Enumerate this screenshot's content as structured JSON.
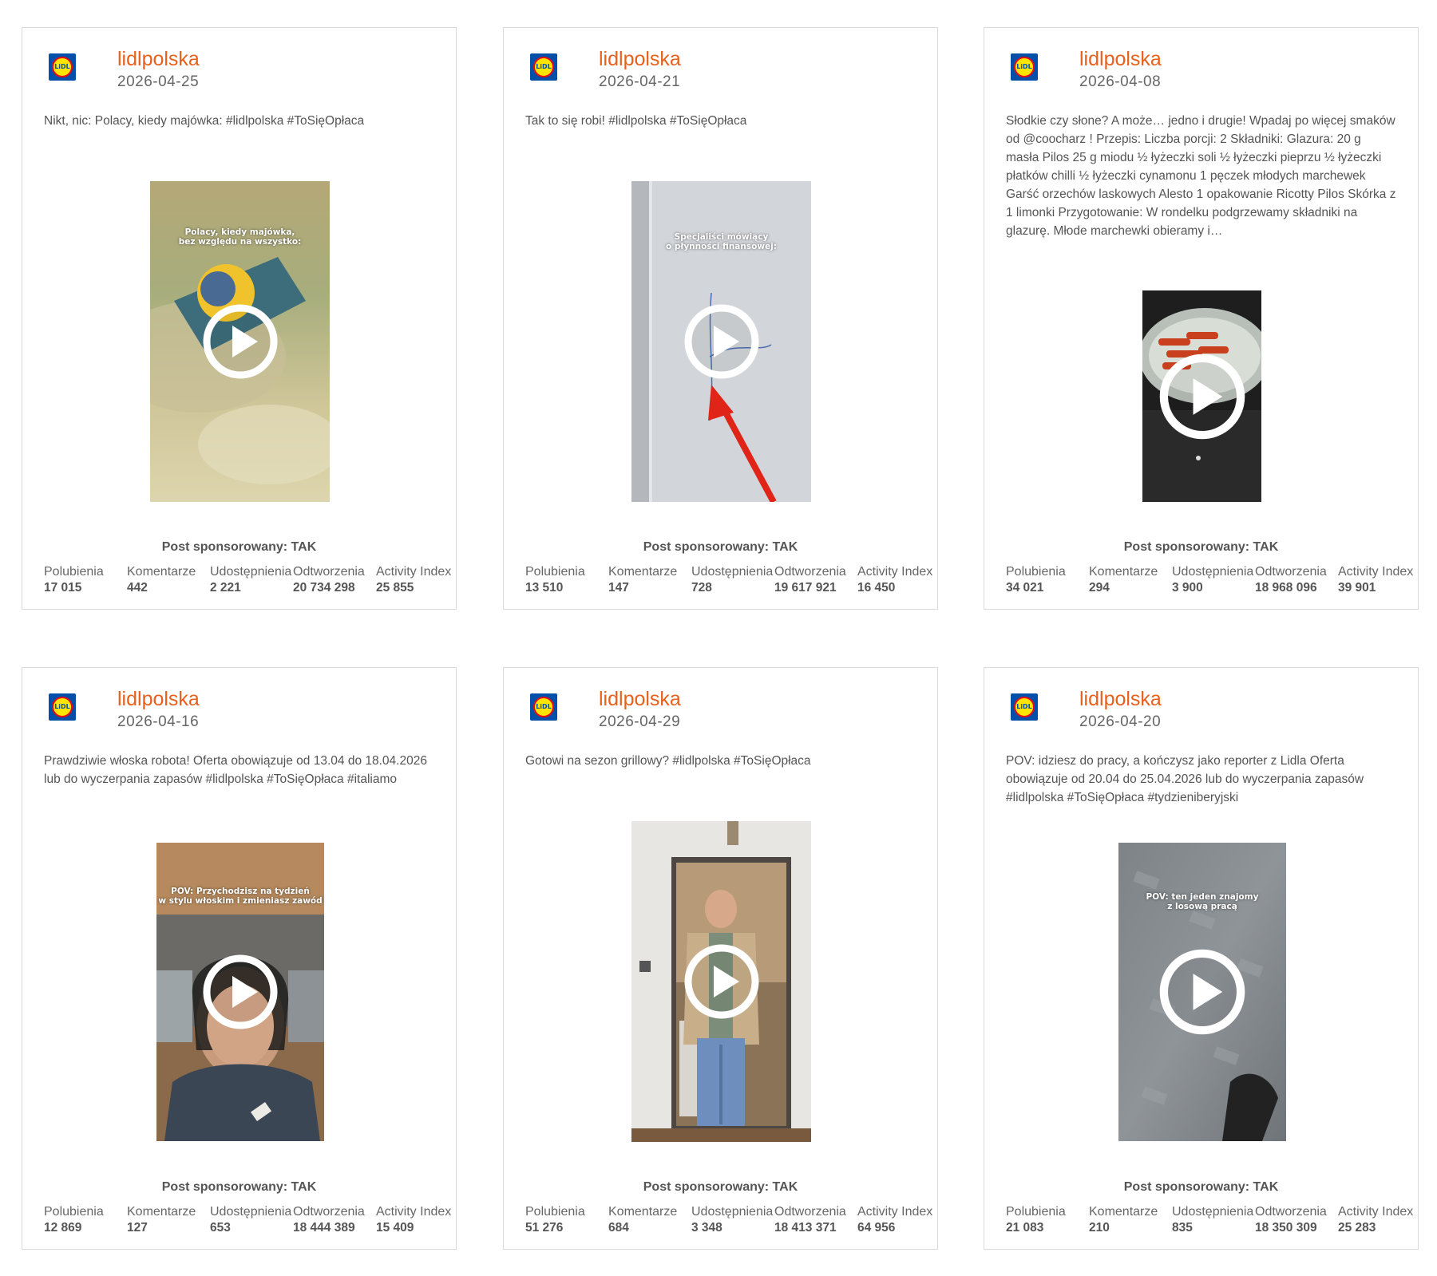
{
  "posts": [
    {
      "author": "lidlpolska",
      "date": "2026-04-25",
      "description": "Nikt, nic: Polacy, kiedy majówka: #lidlpolska #ToSięOpłaca",
      "thumb_text": "Polacy, kiedy majówka,\nbez względu na wszystko:",
      "sponsored": "Post sponsorowany: TAK",
      "stats": [
        {
          "label": "Polubienia",
          "value": "17 015"
        },
        {
          "label": "Komentarze",
          "value": "442"
        },
        {
          "label": "Udostępnienia",
          "value": "2 221"
        },
        {
          "label": "Odtworzenia",
          "value": "20 734 298"
        },
        {
          "label": "Activity Index",
          "value": "25 855"
        }
      ]
    },
    {
      "author": "lidlpolska",
      "date": "2026-04-21",
      "description": "Tak to się robi! #lidlpolska #ToSięOpłaca",
      "thumb_text": "Specjaliści mówiący\no płynności finansowej:",
      "sponsored": "Post sponsorowany: TAK",
      "stats": [
        {
          "label": "Polubienia",
          "value": "13 510"
        },
        {
          "label": "Komentarze",
          "value": "147"
        },
        {
          "label": "Udostępnienia",
          "value": "728"
        },
        {
          "label": "Odtworzenia",
          "value": "19 617 921"
        },
        {
          "label": "Activity Index",
          "value": "16 450"
        }
      ]
    },
    {
      "author": "lidlpolska",
      "date": "2026-04-08",
      "description": "Słodkie czy słone? A może… jedno i drugie! Wpadaj po więcej smaków od @coocharz ! Przepis: Liczba porcji: 2 Składniki: Glazura: 20 g masła Pilos 25 g miodu ½ łyżeczki soli ½ łyżeczki pieprzu ½ łyżeczki płatków chilli ½ łyżeczki cynamonu 1 pęczek młodych marchewek Garść orzechów laskowych Alesto 1 opakowanie Ricotty Pilos Skórka z 1 limonki Przygotowanie: W rondelku podgrzewamy składniki na glazurę. Młode marchewki obieramy i…",
      "thumb_text": "",
      "sponsored": "Post sponsorowany: TAK",
      "stats": [
        {
          "label": "Polubienia",
          "value": "34 021"
        },
        {
          "label": "Komentarze",
          "value": "294"
        },
        {
          "label": "Udostępnienia",
          "value": "3 900"
        },
        {
          "label": "Odtworzenia",
          "value": "18 968 096"
        },
        {
          "label": "Activity Index",
          "value": "39 901"
        }
      ]
    },
    {
      "author": "lidlpolska",
      "date": "2026-04-16",
      "description": "Prawdziwie włoska robota! Oferta obowiązuje od 13.04 do 18.04.2026 lub do wyczerpania zapasów #lidlpolska #ToSięOpłaca #italiamo",
      "thumb_text": "POV: Przychodzisz na tydzień\nw stylu włoskim i zmieniasz zawód",
      "sponsored": "Post sponsorowany: TAK",
      "stats": [
        {
          "label": "Polubienia",
          "value": "12 869"
        },
        {
          "label": "Komentarze",
          "value": "127"
        },
        {
          "label": "Udostępnienia",
          "value": "653"
        },
        {
          "label": "Odtworzenia",
          "value": "18 444 389"
        },
        {
          "label": "Activity Index",
          "value": "15 409"
        }
      ]
    },
    {
      "author": "lidlpolska",
      "date": "2026-04-29",
      "description": "Gotowi na sezon grillowy? #lidlpolska #ToSięOpłaca",
      "thumb_text": "",
      "sponsored": "Post sponsorowany: TAK",
      "stats": [
        {
          "label": "Polubienia",
          "value": "51 276"
        },
        {
          "label": "Komentarze",
          "value": "684"
        },
        {
          "label": "Udostępnienia",
          "value": "3 348"
        },
        {
          "label": "Odtworzenia",
          "value": "18 413 371"
        },
        {
          "label": "Activity Index",
          "value": "64 956"
        }
      ]
    },
    {
      "author": "lidlpolska",
      "date": "2026-04-20",
      "description": "POV: idziesz do pracy, a kończysz jako reporter z Lidla Oferta obowiązuje od 20.04 do 25.04.2026 lub do wyczerpania zapasów #lidlpolska #ToSięOpłaca #tydzieniberyjski",
      "thumb_text": "POV: ten jeden znajomy\nz losową pracą",
      "sponsored": "Post sponsorowany: TAK",
      "stats": [
        {
          "label": "Polubienia",
          "value": "21 083"
        },
        {
          "label": "Komentarze",
          "value": "210"
        },
        {
          "label": "Udostępnienia",
          "value": "835"
        },
        {
          "label": "Odtworzenia",
          "value": "18 350 309"
        },
        {
          "label": "Activity Index",
          "value": "25 283"
        }
      ]
    }
  ]
}
